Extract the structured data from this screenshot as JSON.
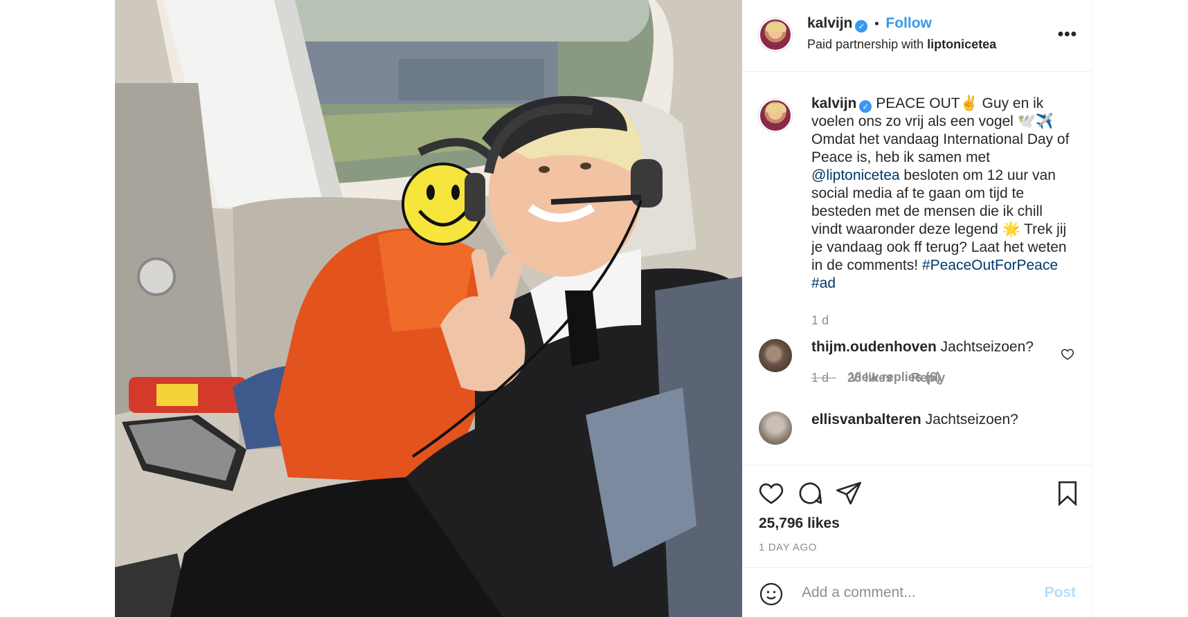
{
  "post": {
    "author": "kalvijn",
    "verified_mark": "✓",
    "follow_label": "Follow",
    "separator": "•",
    "partnership_prefix": "Paid partnership with",
    "partner": "liptonicetea",
    "more_label": "•••"
  },
  "caption": {
    "author": "kalvijn",
    "text_part1": "PEACE OUT✌️ Guy en ik voelen ons zo vrij als een vogel 🕊️✈️ Omdat het vandaag International Day of Peace is, heb ik samen met",
    "mention": "@liptonicetea",
    "text_part2": "besloten om 12 uur van social media af te gaan om tijd te besteden met de mensen die ik chill vindt waaronder deze legend 🌟 Trek jij je vandaag ook ff terug? Laat het weten in de comments!",
    "hashtag1": "#PeaceOutForPeace",
    "hashtag2": "#ad",
    "time": "1 d"
  },
  "comments": [
    {
      "username": "thijm.oudenhoven",
      "text": "Jachtseizoen?",
      "time": "1 d",
      "likes": "26 likes",
      "reply_label": "Reply",
      "view_replies": "View replies (6)"
    },
    {
      "username": "ellisvanbalteren",
      "text": "Jachtseizoen?"
    }
  ],
  "actions": {
    "like_icon": "heart-icon",
    "comment_icon": "speech-bubble-icon",
    "share_icon": "paper-plane-icon",
    "save_icon": "bookmark-icon"
  },
  "likes_count": "25,796 likes",
  "posted_ago": "1 DAY AGO",
  "add_comment": {
    "placeholder": "Add a comment...",
    "post_label": "Post"
  },
  "colors": {
    "accent": "#3897f0",
    "link": "#00376b",
    "muted": "#8e8e8e",
    "post_disabled": "#b2dffc"
  }
}
